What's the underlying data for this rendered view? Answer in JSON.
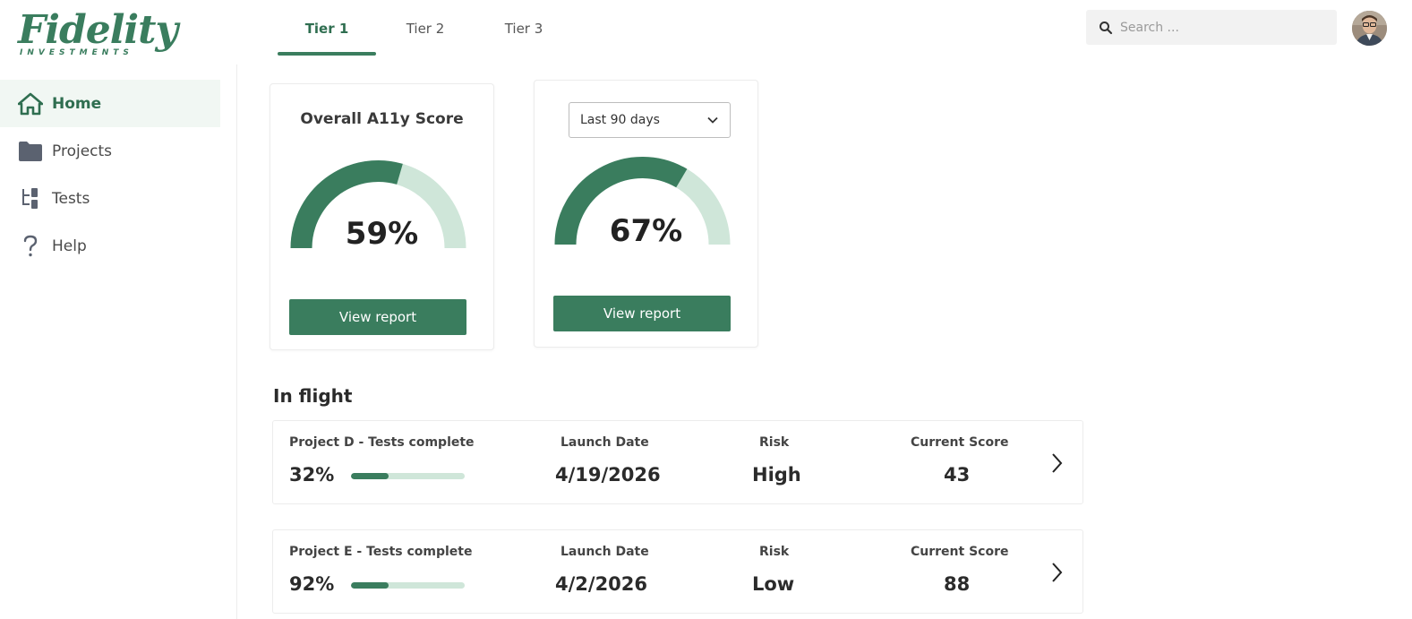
{
  "brand": {
    "name": "Fidelity",
    "sub": "INVESTMENTS",
    "accent": "#3a7d5e",
    "accent_light": "#cfe6d9"
  },
  "sidebar": {
    "items": [
      {
        "label": "Home",
        "icon": "home-icon",
        "active": true
      },
      {
        "label": "Projects",
        "icon": "folder-icon",
        "active": false
      },
      {
        "label": "Tests",
        "icon": "tests-icon",
        "active": false
      },
      {
        "label": "Help",
        "icon": "help-icon",
        "active": false
      }
    ]
  },
  "tabs": [
    {
      "label": "Tier 1",
      "active": true
    },
    {
      "label": "Tier 2",
      "active": false
    },
    {
      "label": "Tier 3",
      "active": false
    }
  ],
  "search": {
    "placeholder": "Search ..."
  },
  "cards": [
    {
      "title": "Overall A11y Score",
      "value": "59%",
      "percent": 59,
      "button": "View report"
    },
    {
      "filter": "Last 90 days",
      "value": "67%",
      "percent": 67,
      "button": "View report"
    }
  ],
  "in_flight": {
    "title": "In flight",
    "rows": [
      {
        "project": "Project D  - Tests complete",
        "progress_label": "32%",
        "progress": 0.33,
        "launch_label": "Launch Date",
        "launch": "4/19/2026",
        "risk_label": "Risk",
        "risk": "High",
        "score_label": "Current Score",
        "score": "43"
      },
      {
        "project": "Project E  - Tests complete",
        "progress_label": "92%",
        "progress": 0.33,
        "launch_label": "Launch Date",
        "launch": "4/2/2026",
        "risk_label": "Risk",
        "risk": "Low",
        "score_label": "Current Score",
        "score": "88"
      }
    ]
  }
}
